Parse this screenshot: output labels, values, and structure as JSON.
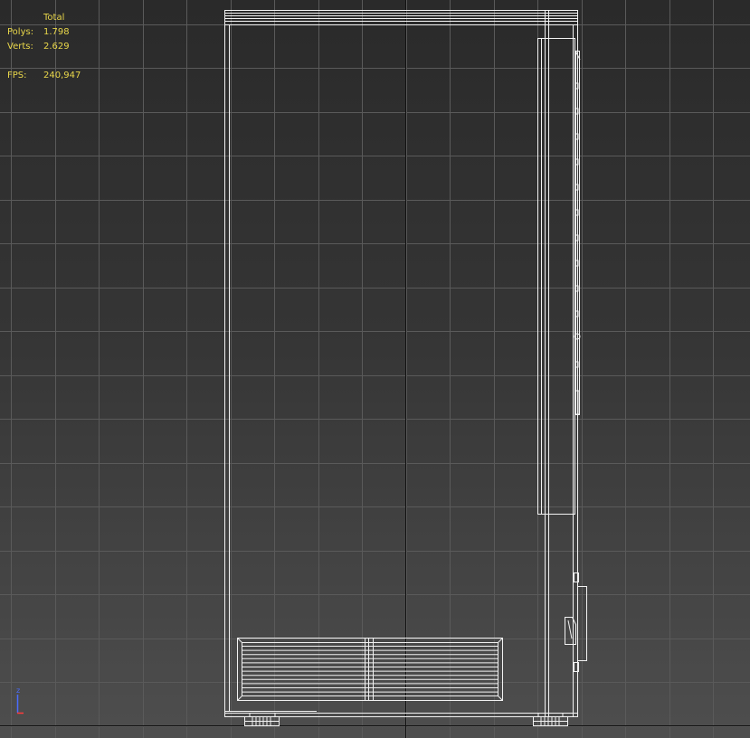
{
  "viewport": {
    "name": "front-view-wireframe",
    "background_top": "#2a2a2a",
    "background_bottom": "#4e4e4e",
    "grid_color": "#5a5a5a",
    "axis_color": "#111111",
    "wire_color": "#f2f2f2"
  },
  "stats": {
    "header": "Total",
    "polys_label": "Polys:",
    "polys_value": "1.798",
    "verts_label": "Verts:",
    "verts_value": "2.629",
    "fps_label": "FPS:",
    "fps_value": "240,947",
    "text_color": "#e8d64a"
  },
  "axis_gizmo": {
    "z_label": "z",
    "z_color": "#4a6cff",
    "x_color": "#ff3b3b"
  }
}
